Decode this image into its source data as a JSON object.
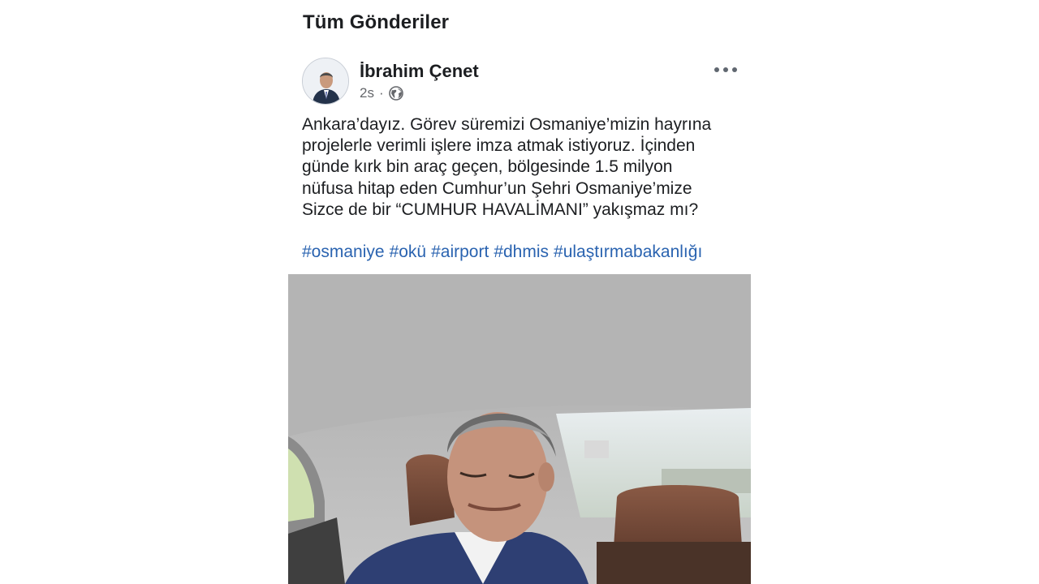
{
  "page": {
    "section_title": "Tüm Gönderiler"
  },
  "post": {
    "author": "İbrahim Çenet",
    "time": "2s",
    "separator": "·",
    "privacy_icon": "globe-icon",
    "menu_icon": "more-horizontal-icon",
    "text_lines": [
      "Ankara’dayız. Görev süremizi Osmaniye’mizin hayrına",
      "projelerle verimli işlere imza atmak istiyoruz. İçinden",
      "günde kırk bin araç geçen, bölgesinde 1.5 milyon",
      "nüfusa hitap eden Cumhur’un Şehri Osmaniye’mize",
      "Sizce de bir “CUMHUR HAVALİMANI” yakışmaz mı?"
    ],
    "hashtags": [
      "#osmaniye",
      "#okü",
      "#airport",
      "#dhmis",
      "#ulaştırmabakanlığı"
    ],
    "hashtag_color": "#2a63b0",
    "media": {
      "type": "video-still"
    }
  }
}
